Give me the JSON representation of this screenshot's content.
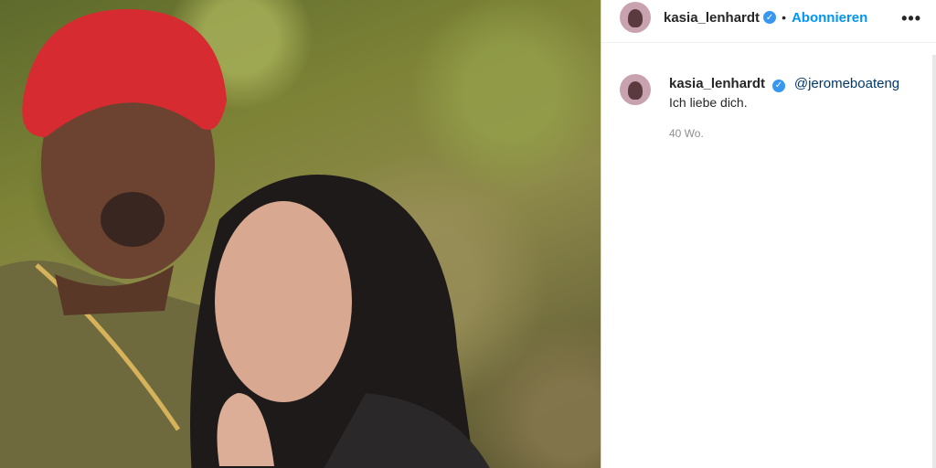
{
  "header": {
    "username": "kasia_lenhardt",
    "separator": "•",
    "follow_label": "Abonnieren",
    "more_label": "•••"
  },
  "comment": {
    "username": "kasia_lenhardt",
    "mention": "@jeromeboateng",
    "caption": "Ich liebe dich.",
    "time": "40 Wo."
  },
  "colors": {
    "accent": "#0095f6",
    "verified": "#3897f0",
    "secondary_text": "#8e8e8e"
  },
  "icons": {
    "verified": "verified-badge-icon",
    "more": "more-options-icon"
  }
}
